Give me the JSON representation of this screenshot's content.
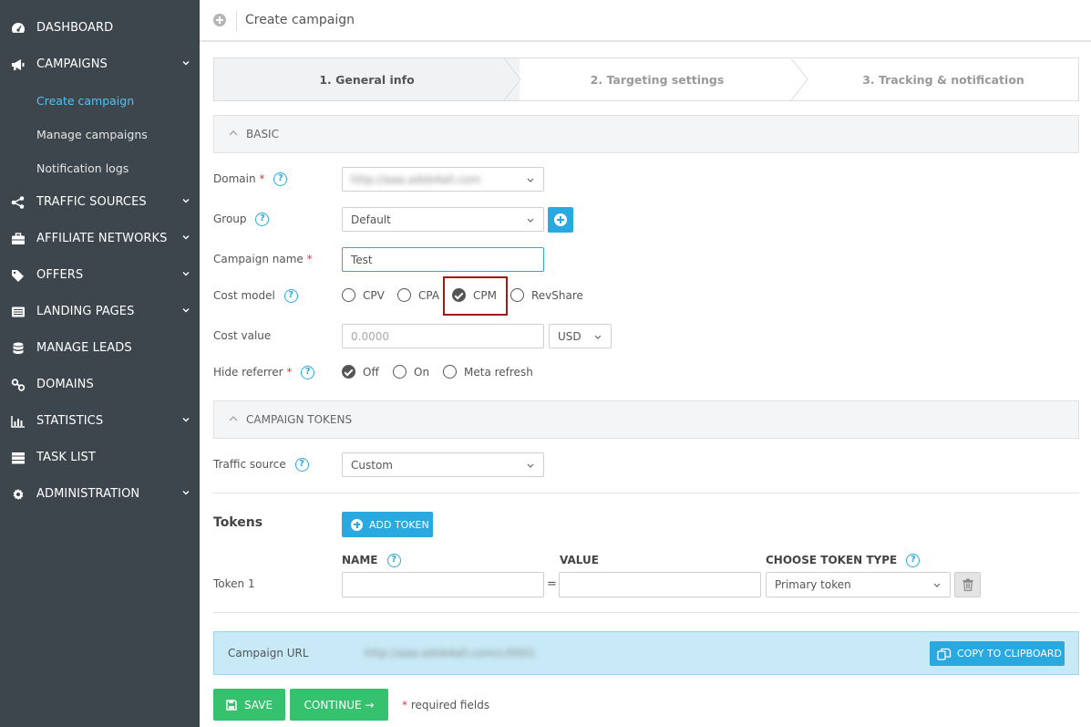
{
  "sidebar": {
    "items": [
      {
        "label": "DASHBOARD",
        "icon": "dashboard-icon"
      },
      {
        "label": "CAMPAIGNS",
        "icon": "megaphone-icon"
      },
      {
        "label": "TRAFFIC SOURCES",
        "icon": "share-icon"
      },
      {
        "label": "AFFILIATE NETWORKS",
        "icon": "briefcase-icon"
      },
      {
        "label": "OFFERS",
        "icon": "tags-icon"
      },
      {
        "label": "LANDING PAGES",
        "icon": "list-icon"
      },
      {
        "label": "MANAGE LEADS",
        "icon": "database-icon"
      },
      {
        "label": "DOMAINS",
        "icon": "link-icon"
      },
      {
        "label": "STATISTICS",
        "icon": "bar-chart-icon"
      },
      {
        "label": "TASK LIST",
        "icon": "server-icon"
      },
      {
        "label": "ADMINISTRATION",
        "icon": "cog-icon"
      }
    ],
    "campaigns_sub": [
      "Create campaign",
      "Manage campaigns",
      "Notification logs"
    ]
  },
  "header": {
    "title": "Create campaign"
  },
  "steps": [
    "1. General info",
    "2. Targeting settings",
    "3. Tracking & notification"
  ],
  "basic": {
    "section_title": "BASIC",
    "domain_label": "Domain",
    "domain_value": "http://aaa.adsb4all.com",
    "group_label": "Group",
    "group_value": "Default",
    "campaign_name_label": "Campaign name",
    "campaign_name_value": "Test",
    "cost_model_label": "Cost model",
    "cost_model_options": [
      "CPV",
      "CPA",
      "CPM",
      "RevShare"
    ],
    "cost_model_selected": "CPM",
    "cost_value_label": "Cost value",
    "cost_value_placeholder": "0.0000",
    "currency": "USD",
    "hide_referrer_label": "Hide referrer",
    "hide_referrer_options": [
      "Off",
      "On",
      "Meta refresh"
    ],
    "hide_referrer_selected": "Off",
    "required_mark": "*",
    "help_mark": "?"
  },
  "tokens_section": {
    "section_title": "CAMPAIGN TOKENS",
    "traffic_source_label": "Traffic source",
    "traffic_source_value": "Custom",
    "tokens_title": "Tokens",
    "add_token_label": "ADD TOKEN",
    "col_name": "NAME",
    "col_value": "VALUE",
    "col_type": "CHOOSE TOKEN TYPE",
    "equals": "=",
    "rows": [
      {
        "label": "Token 1",
        "name": "",
        "value": "",
        "type": "Primary token"
      }
    ]
  },
  "url": {
    "label": "Campaign URL",
    "value": "http://aaa.adsb4all.com/c/0001",
    "copy_label": "COPY TO CLIPBOARD"
  },
  "footer": {
    "save_label": "SAVE",
    "continue_label": "CONTINUE →",
    "required_note": "required fields"
  },
  "colors": {
    "sidebar": "#3d464d",
    "accent": "#2aa9e0",
    "success": "#35c16e",
    "highlight": "#a11818"
  }
}
